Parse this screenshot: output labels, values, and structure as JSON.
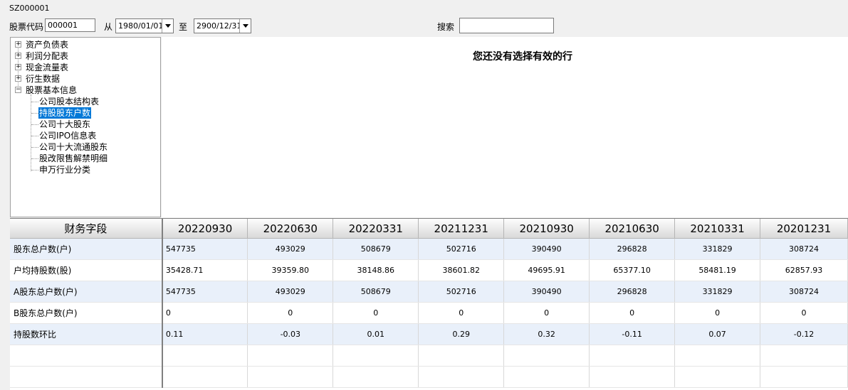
{
  "window_title": "SZ000001",
  "toolbar": {
    "code_label": "股票代码",
    "code_value": "000001",
    "from_label": "从",
    "from_date": "1980/01/01",
    "to_label": "至",
    "to_date": "2900/12/31",
    "search_label": "搜索",
    "search_value": ""
  },
  "tree": {
    "roots": [
      {
        "label": "资产负债表",
        "expander": "+"
      },
      {
        "label": "利润分配表",
        "expander": "+"
      },
      {
        "label": "现金流量表",
        "expander": "+"
      },
      {
        "label": "衍生数据",
        "expander": "+"
      },
      {
        "label": "股票基本信息",
        "expander": "−"
      }
    ],
    "children": [
      {
        "label": "公司股本结构表"
      },
      {
        "label": "持股股东户数"
      },
      {
        "label": "公司十大股东"
      },
      {
        "label": "公司IPO信息表"
      },
      {
        "label": "公司十大流通股东"
      },
      {
        "label": "股改限售解禁明细"
      },
      {
        "label": "申万行业分类"
      }
    ],
    "selected": "持股股东户数"
  },
  "main": {
    "message": "您还没有选择有效的行"
  },
  "grid": {
    "field_header": "财务字段",
    "columns": [
      "20220930",
      "20220630",
      "20220331",
      "20211231",
      "20210930",
      "20210630",
      "20210331",
      "20201231"
    ],
    "rows": [
      {
        "field": "股东总户数(户)",
        "values": [
          "547735",
          "493029",
          "508679",
          "502716",
          "390490",
          "296828",
          "331829",
          "308724"
        ]
      },
      {
        "field": "户均持股数(股)",
        "values": [
          "35428.71",
          "39359.80",
          "38148.86",
          "38601.82",
          "49695.91",
          "65377.10",
          "58481.19",
          "62857.93"
        ]
      },
      {
        "field": "A股东总户数(户)",
        "values": [
          "547735",
          "493029",
          "508679",
          "502716",
          "390490",
          "296828",
          "331829",
          "308724"
        ]
      },
      {
        "field": "B股东总户数(户)",
        "values": [
          "0",
          "0",
          "0",
          "0",
          "0",
          "0",
          "0",
          "0"
        ]
      },
      {
        "field": "持股数环比",
        "values": [
          "0.11",
          "-0.03",
          "0.01",
          "0.29",
          "0.32",
          "-0.11",
          "0.07",
          "-0.12"
        ]
      }
    ]
  }
}
